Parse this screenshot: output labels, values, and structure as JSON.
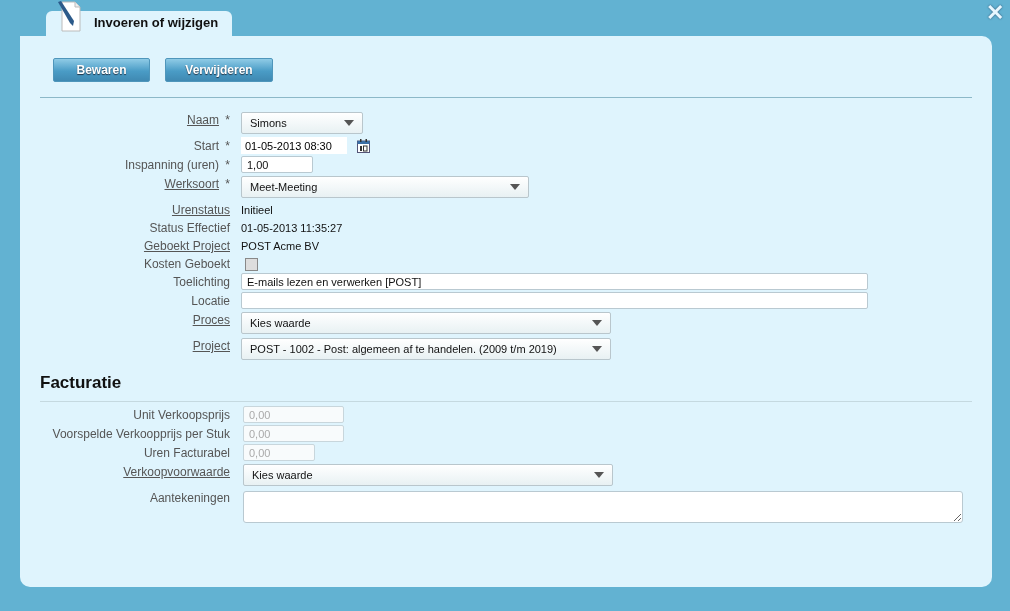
{
  "close_label": "✕",
  "tab": {
    "title": "Invoeren of wijzigen",
    "selected": true
  },
  "toolbar": {
    "buttons": [
      "Bewaren",
      "Verwijderen"
    ]
  },
  "fields": [
    {
      "kind": "select",
      "label": "Naam",
      "link": true,
      "required_mark": "*",
      "value": "Simons"
    },
    {
      "kind": "date",
      "label": "Start",
      "link": false,
      "required_mark": "*",
      "value": "01-05-2013 08:30"
    },
    {
      "kind": "input",
      "label": "Inspanning (uren)",
      "link": false,
      "required_mark": "*",
      "value": "1,00",
      "disabled": false
    },
    {
      "kind": "select",
      "label": "Werksoort",
      "link": true,
      "required_mark": "*",
      "value": "Meet-Meeting"
    },
    {
      "kind": "readonly",
      "label": "Urenstatus",
      "link": true,
      "value": "Initieel"
    },
    {
      "kind": "readonly",
      "label": "Status Effectief",
      "link": false,
      "value": "01-05-2013 11:35:27"
    },
    {
      "kind": "readonly",
      "label": "Geboekt Project",
      "link": true,
      "value": "POST Acme BV"
    },
    {
      "kind": "checkbox",
      "label": "Kosten Geboekt",
      "link": false,
      "checked": false
    },
    {
      "kind": "input",
      "label": "Toelichting",
      "link": false,
      "value": "E-mails lezen en verwerken [POST]",
      "disabled": false
    },
    {
      "kind": "input",
      "label": "Locatie",
      "link": false,
      "disabled": false
    },
    {
      "kind": "select",
      "label": "Proces",
      "link": true,
      "value": "Kies waarde"
    },
    {
      "kind": "select",
      "label": "Project",
      "link": true,
      "value": "POST - 1002 - Post: algemeen af te handelen. (2009 t/m 2019)"
    }
  ],
  "facturatie": {
    "heading": "Facturatie",
    "fields": [
      {
        "kind": "input",
        "label": "Unit Verkoopsprijs",
        "link": false,
        "value": "0,00",
        "disabled": true
      },
      {
        "kind": "input",
        "label": "Voorspelde Verkoopprijs per Stuk",
        "link": false,
        "value": "0,00",
        "disabled": true
      },
      {
        "kind": "input",
        "label": "Uren Facturabel",
        "link": false,
        "value": "0,00",
        "disabled": true
      },
      {
        "kind": "select",
        "label": "Verkoopvoorwaarde",
        "link": true,
        "value": "Kies waarde"
      },
      {
        "kind": "textarea",
        "label": "Aantekeningen",
        "link": false
      }
    ]
  }
}
